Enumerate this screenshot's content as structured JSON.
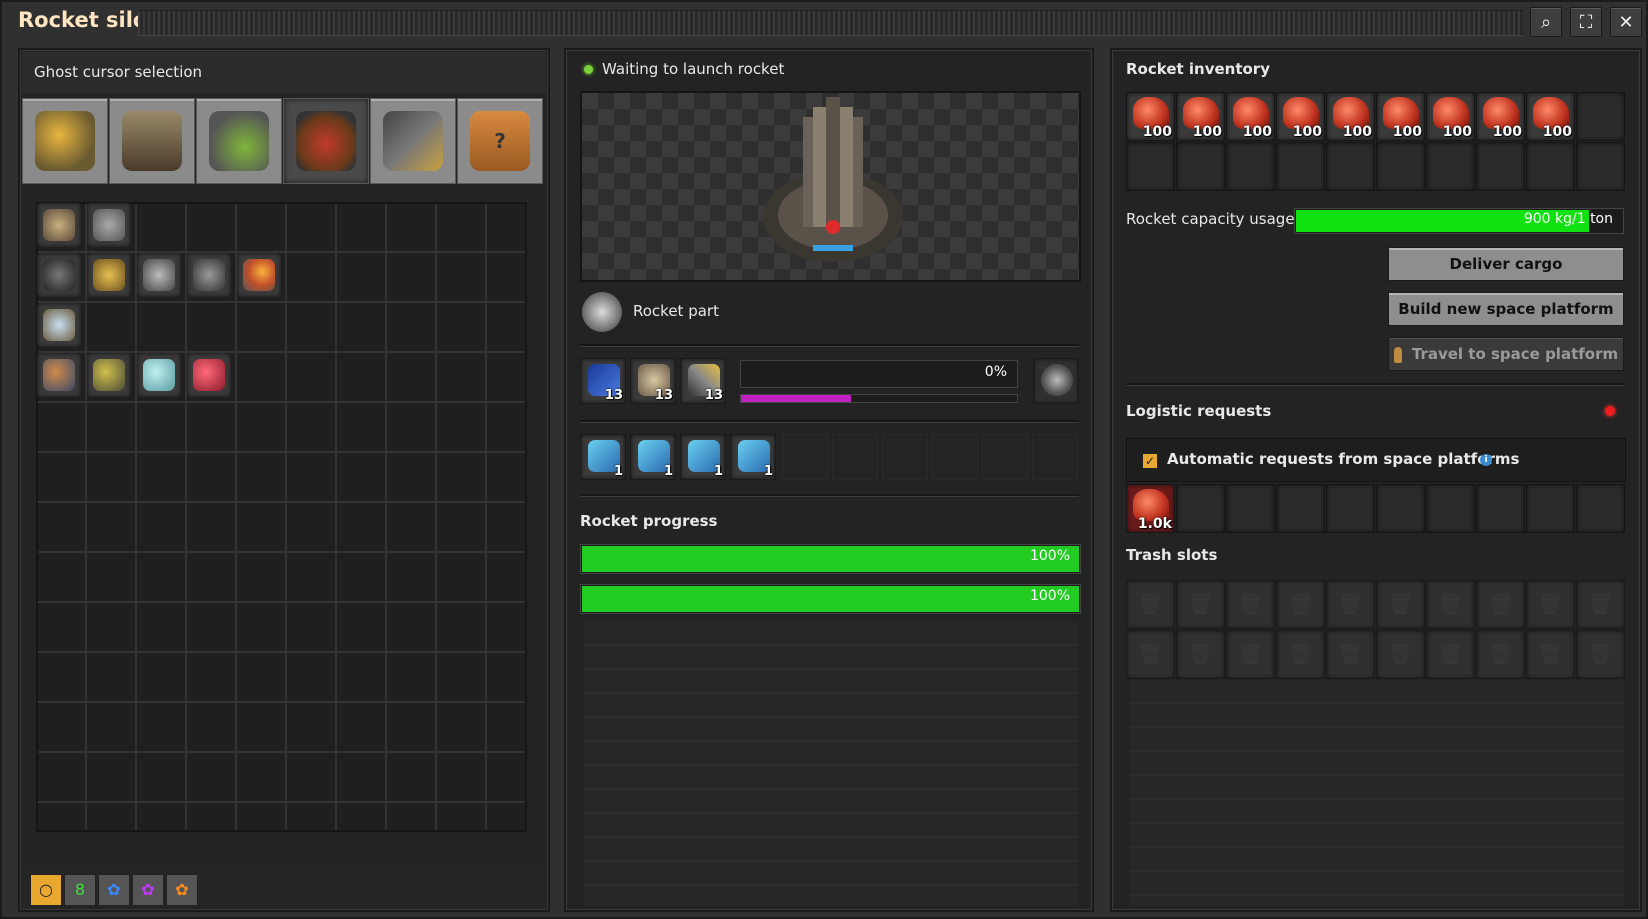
{
  "window": {
    "title": "Rocket silo",
    "buttons": {
      "search": "⌕",
      "tree": "⛶",
      "close": "✕"
    }
  },
  "left": {
    "header": "Ghost cursor selection",
    "categories": [
      "logistics",
      "production",
      "intermediate-products",
      "space",
      "combat",
      "unsorted"
    ],
    "selected_category": "space",
    "qualities": [
      "normal",
      "uncommon",
      "rare",
      "epic",
      "legendary"
    ],
    "selected_quality": "normal"
  },
  "middle": {
    "status": "Waiting to launch rocket",
    "status_color": "#7bd23a",
    "recipe": "Rocket part",
    "ingredients": [
      {
        "icon": "processing-unit-icon",
        "count": "13"
      },
      {
        "icon": "low-density-structure-icon",
        "count": "13"
      },
      {
        "icon": "rocket-fuel-icon",
        "count": "13"
      }
    ],
    "crafting_progress": "0%",
    "crafting_fraction": 0,
    "productivity_fraction": 0.4,
    "modules": [
      {
        "icon": "productivity-module-icon",
        "count": "1"
      },
      {
        "icon": "productivity-module-icon",
        "count": "1"
      },
      {
        "icon": "productivity-module-icon",
        "count": "1"
      },
      {
        "icon": "productivity-module-icon",
        "count": "1"
      }
    ],
    "rocket_progress_label": "Rocket progress",
    "progress_bars": [
      {
        "text": "100%",
        "fraction": 1.0
      },
      {
        "text": "100%",
        "fraction": 1.0
      }
    ]
  },
  "right": {
    "inventory_label": "Rocket inventory",
    "inventory_count": "100",
    "capacity_label": "Rocket capacity usage",
    "capacity_value": "900 kg/1 ton",
    "capacity_fraction": 0.9,
    "buttons": {
      "deliver": "Deliver cargo",
      "build": "Build new space platform",
      "travel": "Travel to space platform"
    },
    "logistic_label": "Logistic requests",
    "auto_requests_label": "Automatic requests from space platforms",
    "request_count": "1.0k",
    "trash_label": "Trash slots"
  }
}
